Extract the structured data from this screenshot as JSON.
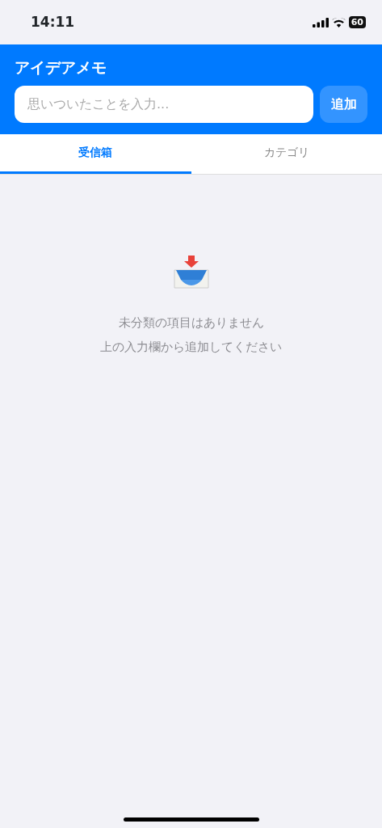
{
  "status_bar": {
    "time": "14:11",
    "battery": "60"
  },
  "header": {
    "title": "アイデアメモ",
    "input": {
      "placeholder": "思いついたことを入力..."
    },
    "add_button": {
      "label": "追加",
      "disabled": true
    }
  },
  "tabs": [
    {
      "label": "受信箱",
      "selected": true
    },
    {
      "label": "カテゴリ",
      "selected": false
    }
  ],
  "empty_state": {
    "lines": [
      "未分類の項目はありません",
      "上の入力欄から追加してください"
    ]
  }
}
